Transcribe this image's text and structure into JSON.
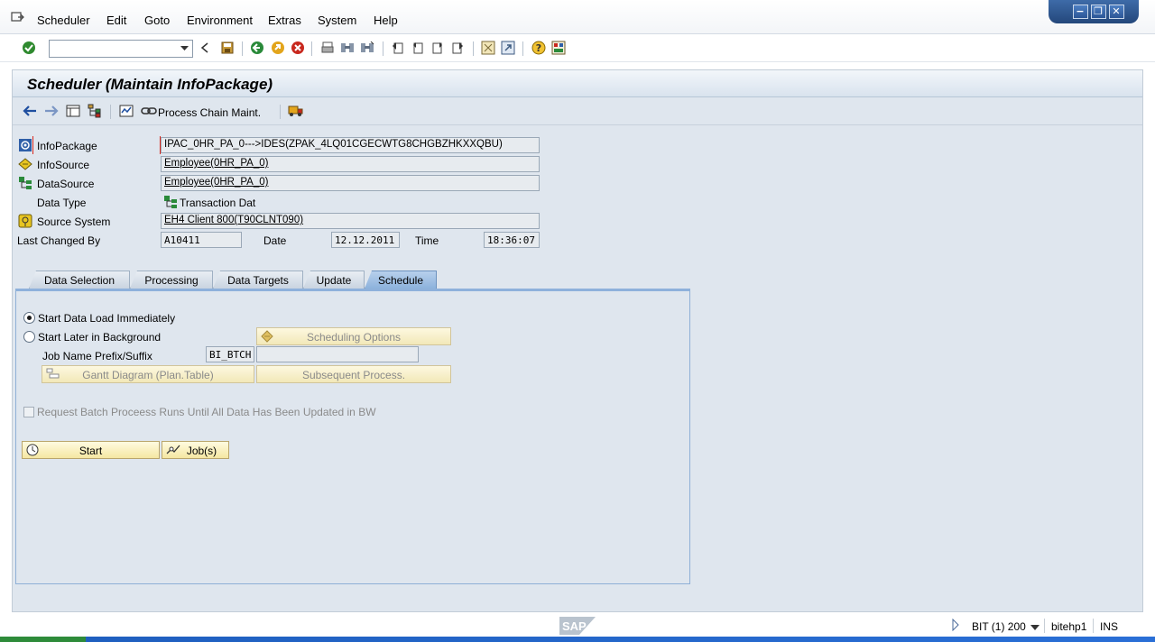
{
  "menu": {
    "items": [
      "Scheduler",
      "Edit",
      "Goto",
      "Environment",
      "Extras",
      "System",
      "Help"
    ]
  },
  "window_controls": {
    "minimize_glyph": "−",
    "restore_glyph": "❐",
    "close_glyph": "✕"
  },
  "toolbar": {
    "command_field_value": "",
    "icons": [
      "enter-icon",
      "back-arrow-icon",
      "save-icon",
      "back-icon",
      "exit-icon",
      "cancel-icon",
      "print-icon",
      "find-icon",
      "find-next-icon",
      "first-page-icon",
      "previous-page-icon",
      "next-page-icon",
      "last-page-icon",
      "create-session-icon",
      "shortcut-icon",
      "help-icon",
      "customize-layout-icon"
    ]
  },
  "page": {
    "title": "Scheduler (Maintain InfoPackage)",
    "app_toolbar": {
      "process_chain_label": "Process Chain Maint."
    }
  },
  "header": {
    "infopackage_label": "InfoPackage",
    "infopackage_value": "IPAC_0HR_PA_0--->IDES(ZPAK_4LQ01CGECWTG8CHGBZHKXXQBU)",
    "infosource_label": "InfoSource",
    "infosource_value": "Employee(0HR_PA_0)",
    "datasource_label": "DataSource",
    "datasource_value": "Employee(0HR_PA_0)",
    "datatype_label": "Data Type",
    "datatype_value": "Transaction Dat",
    "sourcesystem_label": "Source System",
    "sourcesystem_value": "EH4 Client 800(T90CLNT090)",
    "lastchanged_label": "Last Changed By",
    "lastchanged_value": "A10411",
    "date_label": "Date",
    "date_value": "12.12.2011",
    "time_label": "Time",
    "time_value": "18:36:07"
  },
  "tabs": [
    {
      "label": "Data Selection",
      "active": false
    },
    {
      "label": "Processing",
      "active": false
    },
    {
      "label": "Data Targets",
      "active": false
    },
    {
      "label": "Update",
      "active": false
    },
    {
      "label": "Schedule",
      "active": true
    }
  ],
  "schedule": {
    "start_immediately_label": "Start Data Load Immediately",
    "start_immediately_selected": true,
    "start_later_label": "Start Later in Background",
    "start_later_selected": false,
    "scheduling_options_label": "Scheduling Options",
    "job_name_label": "Job Name Prefix/Suffix",
    "job_name_prefix": "BI_BTCH",
    "job_name_suffix": "",
    "gantt_label": "Gantt Diagram (Plan.Table)",
    "subsequent_label": "Subsequent Process.",
    "request_batch_label": "Request Batch Proceess Runs Until All Data Has Been Updated in BW",
    "request_batch_checked": false,
    "start_button_label": "Start",
    "jobs_button_label": "Job(s)"
  },
  "status": {
    "system": "BIT (1) 200",
    "server": "bitehp1",
    "mode": "INS"
  },
  "colors": {
    "accent": "#8eb1db",
    "button_yellow": "#f5e7a2",
    "background": "#dfe6ee"
  }
}
